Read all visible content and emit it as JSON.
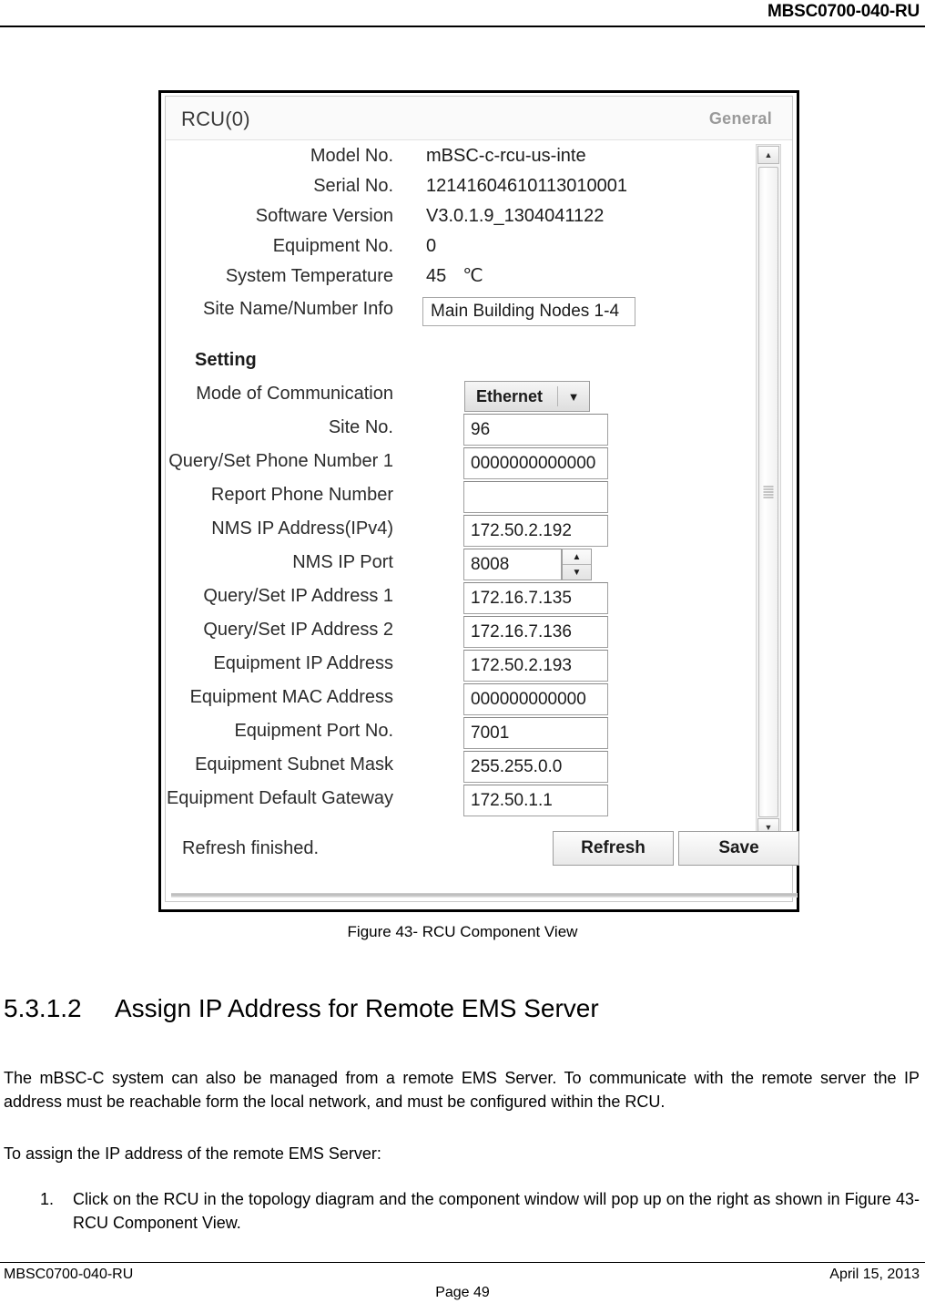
{
  "page_header": {
    "doc_id": "MBSC0700-040-RU"
  },
  "dialog": {
    "title": "RCU(0)",
    "tab": "General",
    "info_rows": [
      {
        "label": "Model No.",
        "value": "mBSC-c-rcu-us-inte"
      },
      {
        "label": "Serial No.",
        "value": "12141604610113010001"
      },
      {
        "label": "Software Version",
        "value": "V3.0.1.9_1304041122"
      },
      {
        "label": "Equipment No.",
        "value": "0"
      },
      {
        "label": "System Temperature",
        "value": "45",
        "unit": "℃"
      }
    ],
    "site_name_label": "Site Name/Number Info",
    "site_name_value": "Main Building Nodes 1-4",
    "setting_title": "Setting",
    "mode_label": "Mode of Communication",
    "mode_value": "Ethernet",
    "mode_arrow": "▼",
    "setting_rows": [
      {
        "label": "Site No.",
        "value": "96"
      },
      {
        "label": "Query/Set Phone Number 1",
        "value": "0000000000000"
      },
      {
        "label": "Report Phone Number",
        "value": ""
      },
      {
        "label": "NMS IP Address(IPv4)",
        "value": "172.50.2.192"
      }
    ],
    "nms_port_label": "NMS IP Port",
    "nms_port_value": "8008",
    "spin_up": "▲",
    "spin_down": "▼",
    "setting_rows2": [
      {
        "label": "Query/Set IP Address 1",
        "value": "172.16.7.135"
      },
      {
        "label": "Query/Set IP Address 2",
        "value": "172.16.7.136"
      },
      {
        "label": "Equipment IP Address",
        "value": "172.50.2.193"
      },
      {
        "label": "Equipment MAC Address",
        "value": "000000000000"
      },
      {
        "label": "Equipment Port No.",
        "value": "7001"
      },
      {
        "label": "Equipment Subnet Mask",
        "value": "255.255.0.0"
      },
      {
        "label": "Equipment Default Gateway",
        "value": "172.50.1.1"
      }
    ],
    "scrollbar": {
      "up_arrow": "▲",
      "down_arrow": "▼"
    },
    "status": "Refresh finished.",
    "refresh_label": "Refresh",
    "save_label": "Save"
  },
  "caption": "Figure 43- RCU Component View",
  "heading": {
    "number": "5.3.1.2",
    "text": "Assign IP Address for Remote EMS Server"
  },
  "paragraphs": {
    "p1": "The mBSC-C system can also be managed from a remote EMS Server. To communicate with the remote server the IP address must be reachable form the local network, and must be configured within the RCU.",
    "p2": "To assign the IP address of the remote EMS Server:"
  },
  "list": [
    {
      "number": "1.",
      "text": "Click on the RCU in the topology diagram and the component window will pop up on the right as shown in Figure 43- RCU Component View."
    }
  ],
  "page_footer": {
    "left": "MBSC0700-040-RU",
    "right": "April 15, 2013",
    "center": "Page 49"
  }
}
